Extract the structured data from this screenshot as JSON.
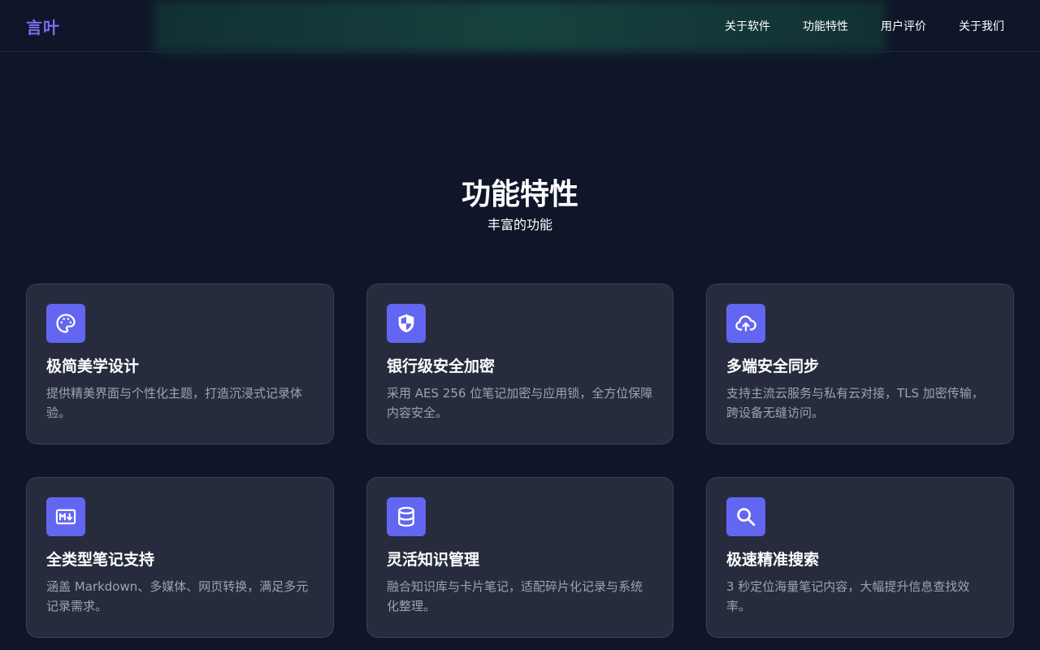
{
  "header": {
    "logo": "言叶",
    "nav": [
      {
        "label": "关于软件"
      },
      {
        "label": "功能特性"
      },
      {
        "label": "用户评价"
      },
      {
        "label": "关于我们"
      }
    ]
  },
  "section": {
    "title": "功能特性",
    "subtitle": "丰富的功能"
  },
  "features": [
    {
      "icon": "palette-icon",
      "title": "极简美学设计",
      "desc": "提供精美界面与个性化主题，打造沉浸式记录体验。"
    },
    {
      "icon": "shield-icon",
      "title": "银行级安全加密",
      "desc": "采用 AES 256 位笔记加密与应用锁，全方位保障内容安全。"
    },
    {
      "icon": "cloud-upload-icon",
      "title": "多端安全同步",
      "desc": "支持主流云服务与私有云对接，TLS 加密传输，跨设备无缝访问。"
    },
    {
      "icon": "markdown-icon",
      "title": "全类型笔记支持",
      "desc": "涵盖 Markdown、多媒体、网页转换，满足多元记录需求。"
    },
    {
      "icon": "database-icon",
      "title": "灵活知识管理",
      "desc": "融合知识库与卡片笔记，适配碎片化记录与系统化整理。"
    },
    {
      "icon": "search-icon",
      "title": "极速精准搜索",
      "desc": "3 秒定位海量笔记内容，大幅提升信息查找效率。"
    }
  ],
  "colors": {
    "background": "#0f1629",
    "card": "#262c3d",
    "accent": "#6366f1",
    "logo": "#7c6cf2",
    "muted_text": "#9ca3af"
  }
}
